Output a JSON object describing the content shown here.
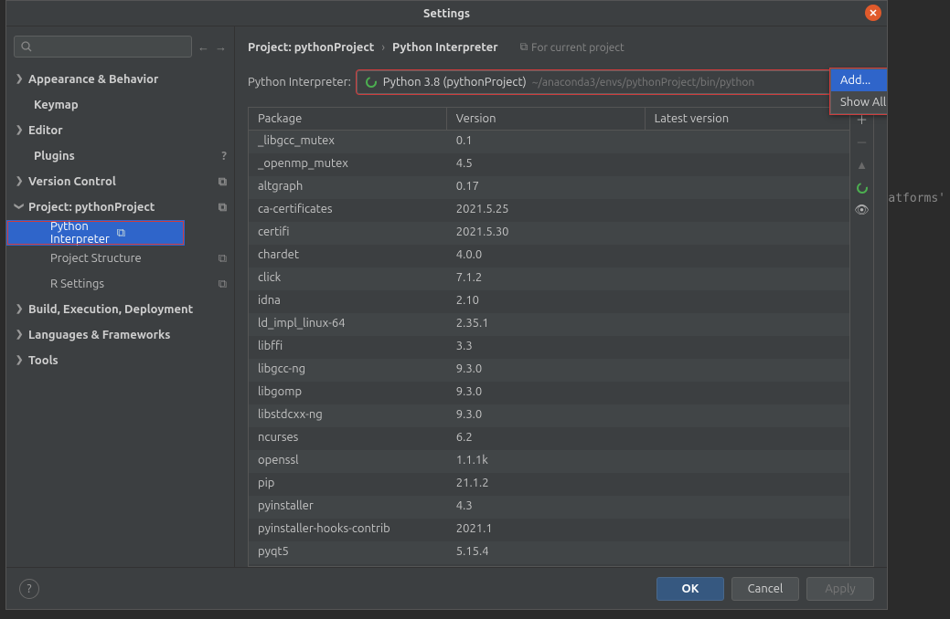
{
  "bg_text": "platforms'",
  "dialog": {
    "title": "Settings"
  },
  "sidebar": {
    "items": [
      {
        "label": "Appearance & Behavior",
        "chevron": true,
        "expanded": false
      },
      {
        "label": "Keymap",
        "chevron": false
      },
      {
        "label": "Editor",
        "chevron": true,
        "expanded": false
      },
      {
        "label": "Plugins",
        "chevron": false,
        "badge": "help"
      },
      {
        "label": "Version Control",
        "chevron": true,
        "expanded": false,
        "badge": "copy"
      },
      {
        "label": "Project: pythonProject",
        "chevron": true,
        "expanded": true,
        "badge": "copy"
      },
      {
        "label": "Python Interpreter",
        "sub": true,
        "selected": true,
        "badge": "copy"
      },
      {
        "label": "Project Structure",
        "sub": true,
        "badge": "copy"
      },
      {
        "label": "R Settings",
        "sub": true,
        "badge": "copy"
      },
      {
        "label": "Build, Execution, Deployment",
        "chevron": true,
        "expanded": false
      },
      {
        "label": "Languages & Frameworks",
        "chevron": true,
        "expanded": false
      },
      {
        "label": "Tools",
        "chevron": true,
        "expanded": false
      }
    ]
  },
  "breadcrumb": {
    "project": "Project: pythonProject",
    "page": "Python Interpreter",
    "hint": "For current project"
  },
  "interpreter": {
    "label": "Python Interpreter:",
    "name": "Python 3.8 (pythonProject)",
    "path": "~/anaconda3/envs/pythonProject/bin/python"
  },
  "gear_menu": {
    "add": "Add...",
    "show_all": "Show All..."
  },
  "packages": {
    "columns": {
      "pkg": "Package",
      "ver": "Version",
      "latest": "Latest version"
    },
    "rows": [
      {
        "name": "_libgcc_mutex",
        "version": "0.1"
      },
      {
        "name": "_openmp_mutex",
        "version": "4.5"
      },
      {
        "name": "altgraph",
        "version": "0.17"
      },
      {
        "name": "ca-certificates",
        "version": "2021.5.25"
      },
      {
        "name": "certifi",
        "version": "2021.5.30"
      },
      {
        "name": "chardet",
        "version": "4.0.0"
      },
      {
        "name": "click",
        "version": "7.1.2"
      },
      {
        "name": "idna",
        "version": "2.10"
      },
      {
        "name": "ld_impl_linux-64",
        "version": "2.35.1"
      },
      {
        "name": "libffi",
        "version": "3.3"
      },
      {
        "name": "libgcc-ng",
        "version": "9.3.0"
      },
      {
        "name": "libgomp",
        "version": "9.3.0"
      },
      {
        "name": "libstdcxx-ng",
        "version": "9.3.0"
      },
      {
        "name": "ncurses",
        "version": "6.2"
      },
      {
        "name": "openssl",
        "version": "1.1.1k"
      },
      {
        "name": "pip",
        "version": "21.1.2"
      },
      {
        "name": "pyinstaller",
        "version": "4.3"
      },
      {
        "name": "pyinstaller-hooks-contrib",
        "version": "2021.1"
      },
      {
        "name": "pyqt5",
        "version": "5.15.4"
      }
    ]
  },
  "footer": {
    "ok": "OK",
    "cancel": "Cancel",
    "apply": "Apply"
  }
}
